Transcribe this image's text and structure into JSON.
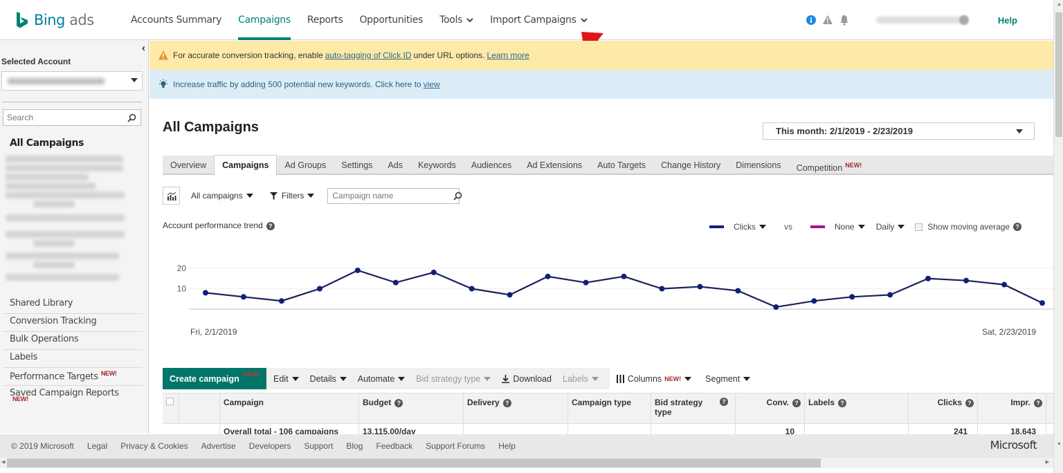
{
  "brand": {
    "name_a": "Bing",
    "name_b": " ads",
    "color": "#008272"
  },
  "nav": {
    "items": [
      {
        "label": "Accounts Summary",
        "active": false
      },
      {
        "label": "Campaigns",
        "active": true
      },
      {
        "label": "Reports",
        "active": false
      },
      {
        "label": "Opportunities",
        "active": false
      },
      {
        "label": "Tools",
        "active": false
      },
      {
        "label": "Import Campaigns",
        "active": false
      }
    ],
    "help": "Help"
  },
  "sidebar": {
    "selected_account_label": "Selected Account",
    "search_placeholder": "Search",
    "all_campaigns": "All Campaigns",
    "links": [
      {
        "label": "Shared Library"
      },
      {
        "label": "Conversion Tracking"
      },
      {
        "label": "Bulk Operations"
      },
      {
        "label": "Labels"
      },
      {
        "label": "Performance Targets",
        "badge": "NEW!"
      },
      {
        "label": "Saved Campaign Reports",
        "badge": "NEW!"
      }
    ]
  },
  "banners": {
    "warning": {
      "pre": "For accurate conversion tracking, enable",
      "link": "auto-tagging of Click ID",
      "post": "under URL options.",
      "learn_more": "Learn more"
    },
    "info": {
      "text": "Increase traffic by adding 500 potential new keywords. Click here to",
      "link": "view"
    }
  },
  "main": {
    "title": "All Campaigns",
    "date_range": "This month: 2/1/2019 - 2/23/2019",
    "tabs": [
      {
        "label": "Overview"
      },
      {
        "label": "Campaigns",
        "active": true
      },
      {
        "label": "Ad Groups"
      },
      {
        "label": "Settings"
      },
      {
        "label": "Ads"
      },
      {
        "label": "Keywords"
      },
      {
        "label": "Audiences"
      },
      {
        "label": "Ad Extensions"
      },
      {
        "label": "Auto Targets"
      },
      {
        "label": "Change History"
      },
      {
        "label": "Dimensions"
      },
      {
        "label": "Competition",
        "badge": "NEW!"
      }
    ],
    "filter_bar": {
      "scope": "All campaigns",
      "filters": "Filters",
      "campaign_name_placeholder": "Campaign name"
    },
    "trend": {
      "title": "Account performance trend",
      "metric1": "Clicks",
      "metric1_color": "#0f1f7a",
      "vs": "vs",
      "metric2": "None",
      "metric2_color": "#a0168c",
      "granularity": "Daily",
      "moving_average": "Show moving average",
      "moving_average_checked": false
    },
    "grid_toolbar": {
      "create": "Create campaign",
      "create_badge": "NEW!",
      "edit": "Edit",
      "details": "Details",
      "automate": "Automate",
      "bid_strategy_type": "Bid strategy type",
      "download": "Download",
      "labels": "Labels",
      "columns": "Columns",
      "columns_badge": "NEW!",
      "segment": "Segment"
    },
    "table": {
      "columns": [
        "Campaign",
        "Budget",
        "Delivery",
        "Campaign type",
        "Bid strategy type",
        "Conv.",
        "Labels",
        "Clicks",
        "Impr."
      ],
      "total_row": {
        "campaign": "Overall total - 106 campaigns",
        "budget": "13,115.00/day",
        "conv": "10",
        "clicks": "241",
        "impr": "18,643"
      }
    }
  },
  "footer": {
    "links": [
      "© 2019 Microsoft",
      "Legal",
      "Privacy & Cookies",
      "Advertise",
      "Developers",
      "Support",
      "Blog",
      "Feedback",
      "Support Forums",
      "Help"
    ],
    "brand": "Microsoft"
  },
  "chart_data": {
    "type": "line",
    "title": "Account performance trend",
    "series": [
      {
        "name": "Clicks",
        "values": [
          8,
          6,
          4,
          10,
          19,
          13,
          18,
          10,
          7,
          16,
          13,
          16,
          10,
          11,
          9,
          1,
          4,
          6,
          7,
          15,
          14,
          12,
          3
        ]
      }
    ],
    "x_start_label": "Fri, 2/1/2019",
    "x_end_label": "Sat, 2/23/2019",
    "x_count": 23,
    "y_ticks": [
      10,
      20
    ],
    "ylim": [
      0,
      20
    ],
    "grid": true,
    "line_color": "#0f1f7a"
  }
}
